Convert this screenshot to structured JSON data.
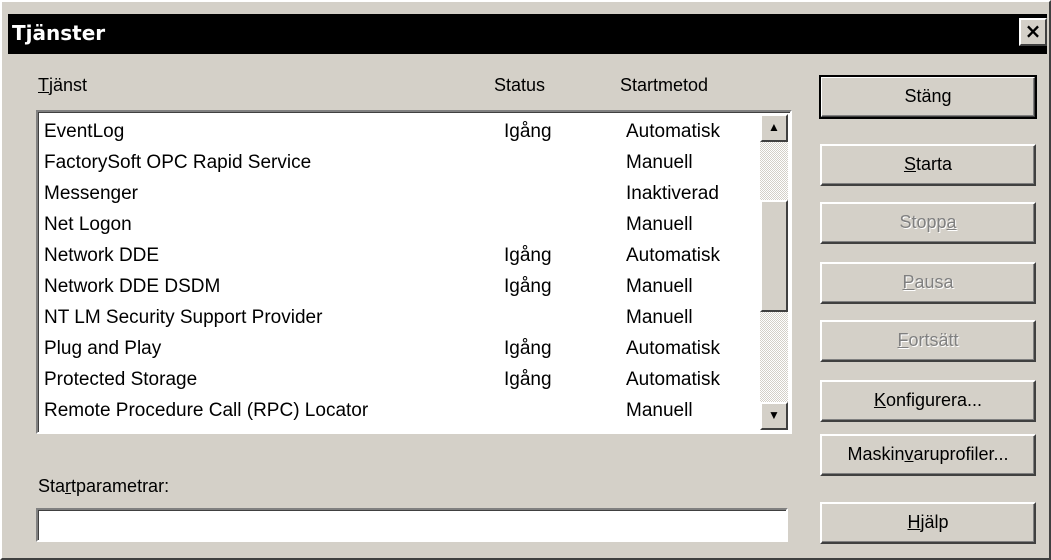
{
  "window": {
    "title": "Tjänster",
    "close_glyph": "×"
  },
  "columns": {
    "service_prefix": "T",
    "service_rest": "jänst",
    "status": "Status",
    "startup": "Startmetod"
  },
  "services": [
    {
      "name": "EventLog",
      "status": "Igång",
      "startup": "Automatisk"
    },
    {
      "name": "FactorySoft OPC Rapid Service",
      "status": "",
      "startup": "Manuell"
    },
    {
      "name": "Messenger",
      "status": "",
      "startup": "Inaktiverad"
    },
    {
      "name": "Net Logon",
      "status": "",
      "startup": "Manuell"
    },
    {
      "name": "Network DDE",
      "status": "Igång",
      "startup": "Automatisk"
    },
    {
      "name": "Network DDE DSDM",
      "status": "Igång",
      "startup": "Manuell"
    },
    {
      "name": "NT LM Security Support Provider",
      "status": "",
      "startup": "Manuell"
    },
    {
      "name": "Plug and Play",
      "status": "Igång",
      "startup": "Automatisk"
    },
    {
      "name": "Protected Storage",
      "status": "Igång",
      "startup": "Automatisk"
    },
    {
      "name": "Remote Procedure Call (RPC) Locator",
      "status": "",
      "startup": "Manuell"
    }
  ],
  "scrollbar": {
    "up_glyph": "▲",
    "down_glyph": "▼"
  },
  "buttons": {
    "close": {
      "label": "Stäng"
    },
    "start": {
      "accel": "S",
      "rest": "tarta"
    },
    "stop": {
      "pre": "Stopp",
      "accel": "a"
    },
    "pause": {
      "accel": "P",
      "rest": "ausa"
    },
    "resume": {
      "accel": "F",
      "rest": "ortsätt"
    },
    "configure": {
      "accel": "K",
      "rest": "onfigurera..."
    },
    "hw_profiles": {
      "pre": "Maskin",
      "accel": "v",
      "rest": "aruprofiler..."
    },
    "help": {
      "accel": "H",
      "rest": "jälp"
    }
  },
  "params": {
    "label_pre": "Sta",
    "label_accel": "r",
    "label_rest": "tparametrar:",
    "value": ""
  }
}
